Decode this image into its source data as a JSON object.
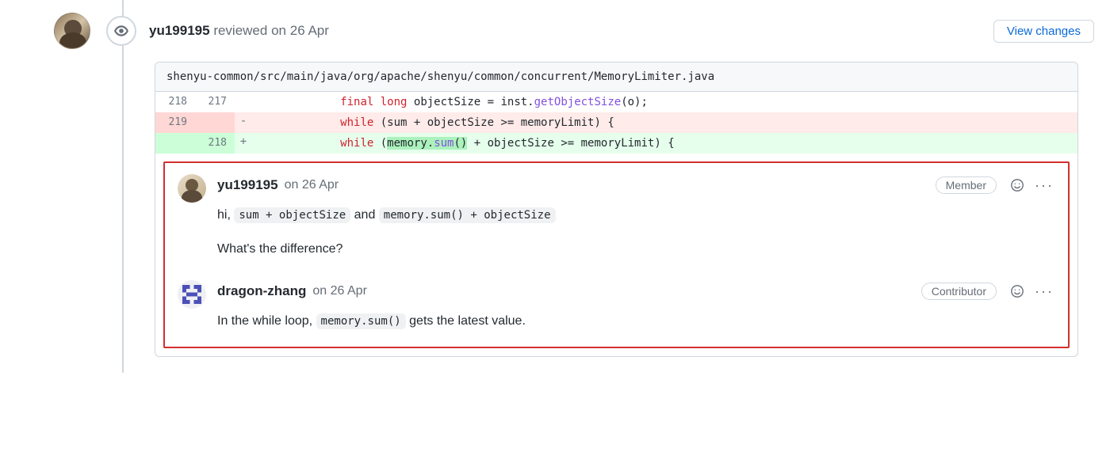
{
  "review": {
    "author": "yu199195",
    "action_text": "reviewed",
    "date_prefix": "on",
    "date": "26 Apr",
    "view_changes_label": "View changes"
  },
  "file": {
    "path": "shenyu-common/src/main/java/org/apache/shenyu/common/concurrent/MemoryLimiter.java"
  },
  "diff": {
    "rows": [
      {
        "old": "218",
        "new": "217",
        "marker": "",
        "kind": "context"
      },
      {
        "old": "219",
        "new": "",
        "marker": "-",
        "kind": "del"
      },
      {
        "old": "",
        "new": "218",
        "marker": "+",
        "kind": "add"
      }
    ],
    "ctx": {
      "indent": "            ",
      "kw_final": "final",
      "kw_long": " long",
      "rest1": " objectSize = inst.",
      "method": "getObjectSize",
      "rest2": "(o);"
    },
    "del": {
      "indent": "            ",
      "kw_while": "while",
      "rest": " (sum + objectSize >= memoryLimit) {"
    },
    "add": {
      "indent": "            ",
      "kw_while": "while",
      "rest1": " (",
      "hl1": "memory.",
      "hl_method": "sum",
      "hl2": "()",
      "rest2": " + objectSize >= memoryLimit) {"
    }
  },
  "comments": [
    {
      "author": "yu199195",
      "date_prefix": "on",
      "date": "26 Apr",
      "role": "Member",
      "avatar_kind": "photo",
      "body": {
        "line1_pre": "hi, ",
        "code1": "sum + objectSize",
        "line1_mid": " and ",
        "code2": "memory.sum() + objectSize",
        "line2": "What's the difference?"
      }
    },
    {
      "author": "dragon-zhang",
      "date_prefix": "on",
      "date": "26 Apr",
      "role": "Contributor",
      "avatar_kind": "identicon",
      "body": {
        "line1_pre": "In the while loop, ",
        "code1": "memory.sum()",
        "line1_post": " gets the latest value."
      }
    }
  ]
}
